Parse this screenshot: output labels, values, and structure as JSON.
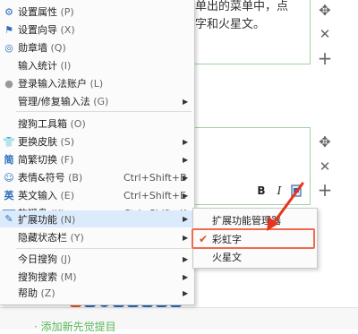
{
  "background": {
    "line1": "单出的菜单中，点",
    "line2": "字和火星文。",
    "bottom_text": "· 添加新先觉提目",
    "mini_tools": {
      "bold": "B",
      "italic": "I"
    }
  },
  "menu": {
    "items": [
      {
        "label": "设置属性",
        "shortcut": "",
        "hotkey": "(P)",
        "icon": "gear-icon",
        "arrow": false
      },
      {
        "label": "设置向导",
        "shortcut": "",
        "hotkey": "(X)",
        "icon": "flag-icon",
        "arrow": false
      },
      {
        "label": "勋章墙",
        "shortcut": "",
        "hotkey": "(Q)",
        "icon": "medal-icon",
        "arrow": false
      },
      {
        "label": "输入统计",
        "shortcut": "",
        "hotkey": "(I)",
        "icon": "",
        "arrow": false
      },
      {
        "label": "登录输入法账户",
        "shortcut": "",
        "hotkey": "(L)",
        "icon": "user-icon",
        "arrow": false
      },
      {
        "label": "管理/修复输入法",
        "shortcut": "",
        "hotkey": "(G)",
        "icon": "",
        "arrow": true
      },
      {
        "label": "搜狗工具箱",
        "shortcut": "",
        "hotkey": "(O)",
        "icon": "",
        "arrow": false
      },
      {
        "label": "更换皮肤",
        "shortcut": "",
        "hotkey": "(S)",
        "icon": "shirt-icon",
        "arrow": true
      },
      {
        "label": "简繁切换",
        "shortcut": "",
        "hotkey": "(F)",
        "icon": "jian-icon",
        "arrow": true
      },
      {
        "label": "表情&符号",
        "shortcut": "Ctrl+Shift+B",
        "hotkey": "(B)",
        "icon": "smiley-icon",
        "arrow": true
      },
      {
        "label": "英文输入",
        "shortcut": "Ctrl+Shift+E",
        "hotkey": "(E)",
        "icon": "english-icon",
        "arrow": true
      },
      {
        "label": "软键盘",
        "shortcut": "Ctrl+Shift+K",
        "hotkey": "(K)",
        "icon": "keyboard-icon",
        "arrow": true
      },
      {
        "label": "扩展功能",
        "shortcut": "",
        "hotkey": "(N)",
        "icon": "extension-icon",
        "arrow": true
      },
      {
        "label": "隐藏状态栏",
        "shortcut": "",
        "hotkey": "(Y)",
        "icon": "",
        "arrow": true
      },
      {
        "label": "今日搜狗",
        "shortcut": "",
        "hotkey": "(J)",
        "icon": "",
        "arrow": true
      },
      {
        "label": "搜狗搜索",
        "shortcut": "",
        "hotkey": "(M)",
        "icon": "",
        "arrow": true
      },
      {
        "label": "帮助",
        "shortcut": "",
        "hotkey": "(Z)",
        "icon": "",
        "arrow": true
      }
    ]
  },
  "submenu": {
    "items": [
      {
        "label": "扩展功能管理器",
        "checked": false
      },
      {
        "label": "彩虹字",
        "checked": true
      },
      {
        "label": "火星文",
        "checked": false
      }
    ]
  },
  "colors": {
    "accent": "#2a6ebc",
    "hover": "#dcebfc",
    "highlight": "#f06b4f",
    "check": "#e74c1c"
  }
}
